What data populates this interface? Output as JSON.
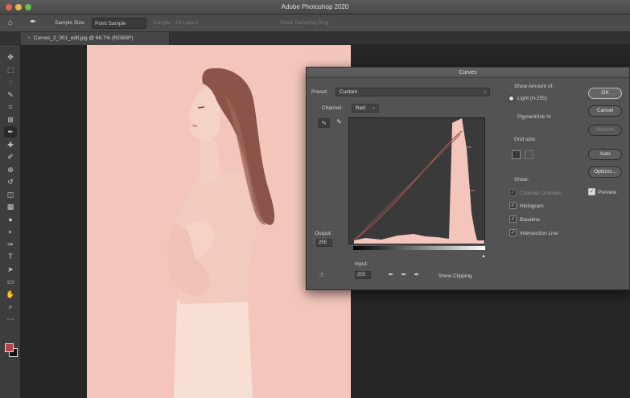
{
  "window": {
    "title": "Adobe Photoshop 2020"
  },
  "options_bar": {
    "home_icon": "home-icon",
    "tool_icon": "eyedropper-icon",
    "sample_size_label": "Sample Size:",
    "sample_size_value": "Point Sample",
    "sample_label": "Sample",
    "sample_value": "All Layers",
    "show_ring_label": "Show Sampling Ring"
  },
  "document": {
    "tab_title": "Curves_2_001_edit.jpg @ 66.7% (RGB/8*)",
    "close_symbol": "×"
  },
  "tools": {
    "icons": [
      "move-icon",
      "marquee-icon",
      "lasso-icon",
      "quick-select-icon",
      "crop-icon",
      "frame-icon",
      "eyedropper-icon",
      "healing-icon",
      "brush-icon",
      "clone-stamp-icon",
      "history-brush-icon",
      "eraser-icon",
      "gradient-icon",
      "blur-icon",
      "dodge-icon",
      "pen-icon",
      "type-icon",
      "path-select-icon",
      "rectangle-icon",
      "hand-icon",
      "zoom-icon",
      "more-icon"
    ],
    "glyphs": [
      "✥",
      "⬚",
      "◌",
      "✎",
      "⌗",
      "⊠",
      "✒",
      "✚",
      "✐",
      "⊕",
      "↺",
      "◫",
      "▦",
      "●",
      "◐",
      "✑",
      "T",
      "➤",
      "▭",
      "✋",
      "⌕",
      "⋯"
    ],
    "foreground_color": "#b5434d",
    "background_color": "#111111"
  },
  "curves_dialog": {
    "title": "Curves",
    "preset_label": "Preset:",
    "preset_value": "Custom",
    "channel_label": "Channel:",
    "channel_value": "Red",
    "output_label": "Output:",
    "output_value": "255",
    "input_label": "Input:",
    "input_value": "255",
    "show_amount_label": "Show Amount of:",
    "light_label": "Light  (0-255)",
    "pigment_label": "Pigment/Ink %",
    "grid_size_label": "Grid size:",
    "show_label": "Show:",
    "channel_overlays_label": "Channel Overlays",
    "histogram_label": "Histogram",
    "baseline_label": "Baseline",
    "intersection_label": "Intersection Line",
    "show_clipping_label": "Show Clipping",
    "preview_label": "Preview",
    "buttons": {
      "ok": "OK",
      "cancel": "Cancel",
      "smooth": "Smooth",
      "auto": "Auto",
      "options": "Options..."
    },
    "checked_symbol": "✓",
    "accent_color": "#f4c6bb"
  },
  "photo": {
    "background_color": "#f4c6bb",
    "hair_color": "#8a5448",
    "skin_color": "#f3cfc1",
    "skirt_color": "#f7dfd3"
  }
}
